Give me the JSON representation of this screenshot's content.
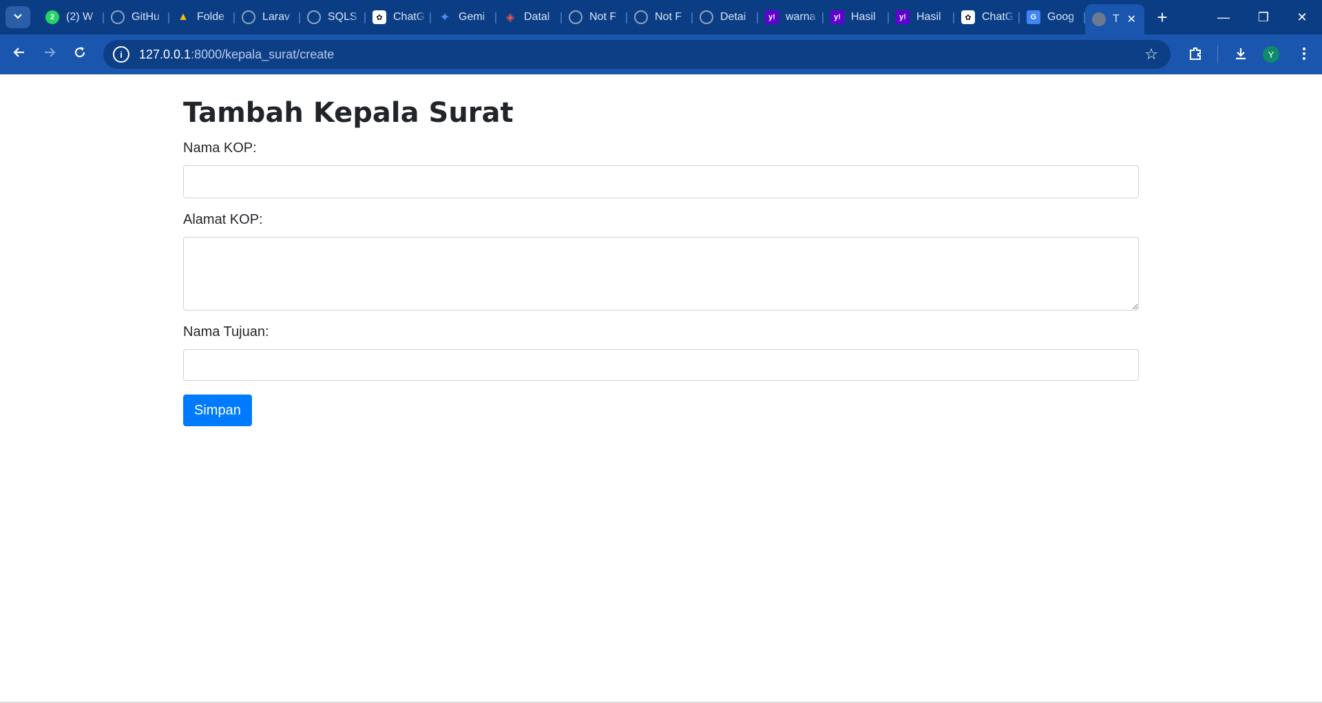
{
  "browser": {
    "tabs": [
      {
        "label": "(2) W",
        "icon": "whatsapp-icon",
        "color": "#25d366",
        "glyph": "2"
      },
      {
        "label": "GitHu",
        "icon": "github-icon",
        "color": "#24292e",
        "glyph": ""
      },
      {
        "label": "Folde",
        "icon": "google-drive-icon",
        "color": "#1fa463",
        "glyph": "▲"
      },
      {
        "label": "Larav",
        "icon": "github-icon",
        "color": "#24292e",
        "glyph": ""
      },
      {
        "label": "SQLS",
        "icon": "globe-icon",
        "color": "#6c7a8f",
        "glyph": ""
      },
      {
        "label": "ChatG",
        "icon": "chatgpt-icon",
        "color": "#ffffff",
        "glyph": "✿"
      },
      {
        "label": "Gemi",
        "icon": "gemini-icon",
        "color": "#0b3d85",
        "glyph": "✦"
      },
      {
        "label": "Datal",
        "icon": "laravel-icon",
        "color": "#0b3d85",
        "glyph": "◈"
      },
      {
        "label": "Not F",
        "icon": "globe-icon",
        "color": "#6c7a8f",
        "glyph": ""
      },
      {
        "label": "Not F",
        "icon": "globe-icon",
        "color": "#6c7a8f",
        "glyph": ""
      },
      {
        "label": "Detai",
        "icon": "globe-icon",
        "color": "#6c7a8f",
        "glyph": ""
      },
      {
        "label": "warna",
        "icon": "yahoo-icon",
        "color": "#6001d2",
        "glyph": "y!"
      },
      {
        "label": "Hasil",
        "icon": "yahoo-icon",
        "color": "#6001d2",
        "glyph": "y!"
      },
      {
        "label": "Hasil",
        "icon": "yahoo-icon",
        "color": "#6001d2",
        "glyph": "y!"
      },
      {
        "label": "ChatG",
        "icon": "chatgpt-icon",
        "color": "#ffffff",
        "glyph": "✿"
      },
      {
        "label": "Goog",
        "icon": "google-translate-icon",
        "color": "#4285f4",
        "glyph": "G"
      }
    ],
    "active_tab": {
      "label": "T",
      "icon": "globe-icon",
      "close": "✕"
    },
    "new_tab": "+",
    "window": {
      "minimize": "—",
      "restore": "❐",
      "close": "✕"
    },
    "url_host": "127.0.0.1",
    "url_path": ":8000/kepala_surat/create",
    "info_glyph": "i",
    "profile_initial": "Y"
  },
  "form": {
    "title": "Tambah Kepala Surat",
    "fields": {
      "nama_kop_label": "Nama KOP:",
      "nama_kop_value": "",
      "alamat_kop_label": "Alamat KOP:",
      "alamat_kop_value": "",
      "nama_tujuan_label": "Nama Tujuan:",
      "nama_tujuan_value": ""
    },
    "submit_label": "Simpan"
  },
  "colors": {
    "tabstrip": "#0b3d85",
    "toolbar": "#1a56ad",
    "primary_button": "#007bff",
    "text": "#212529",
    "input_border": "#ced4da"
  }
}
